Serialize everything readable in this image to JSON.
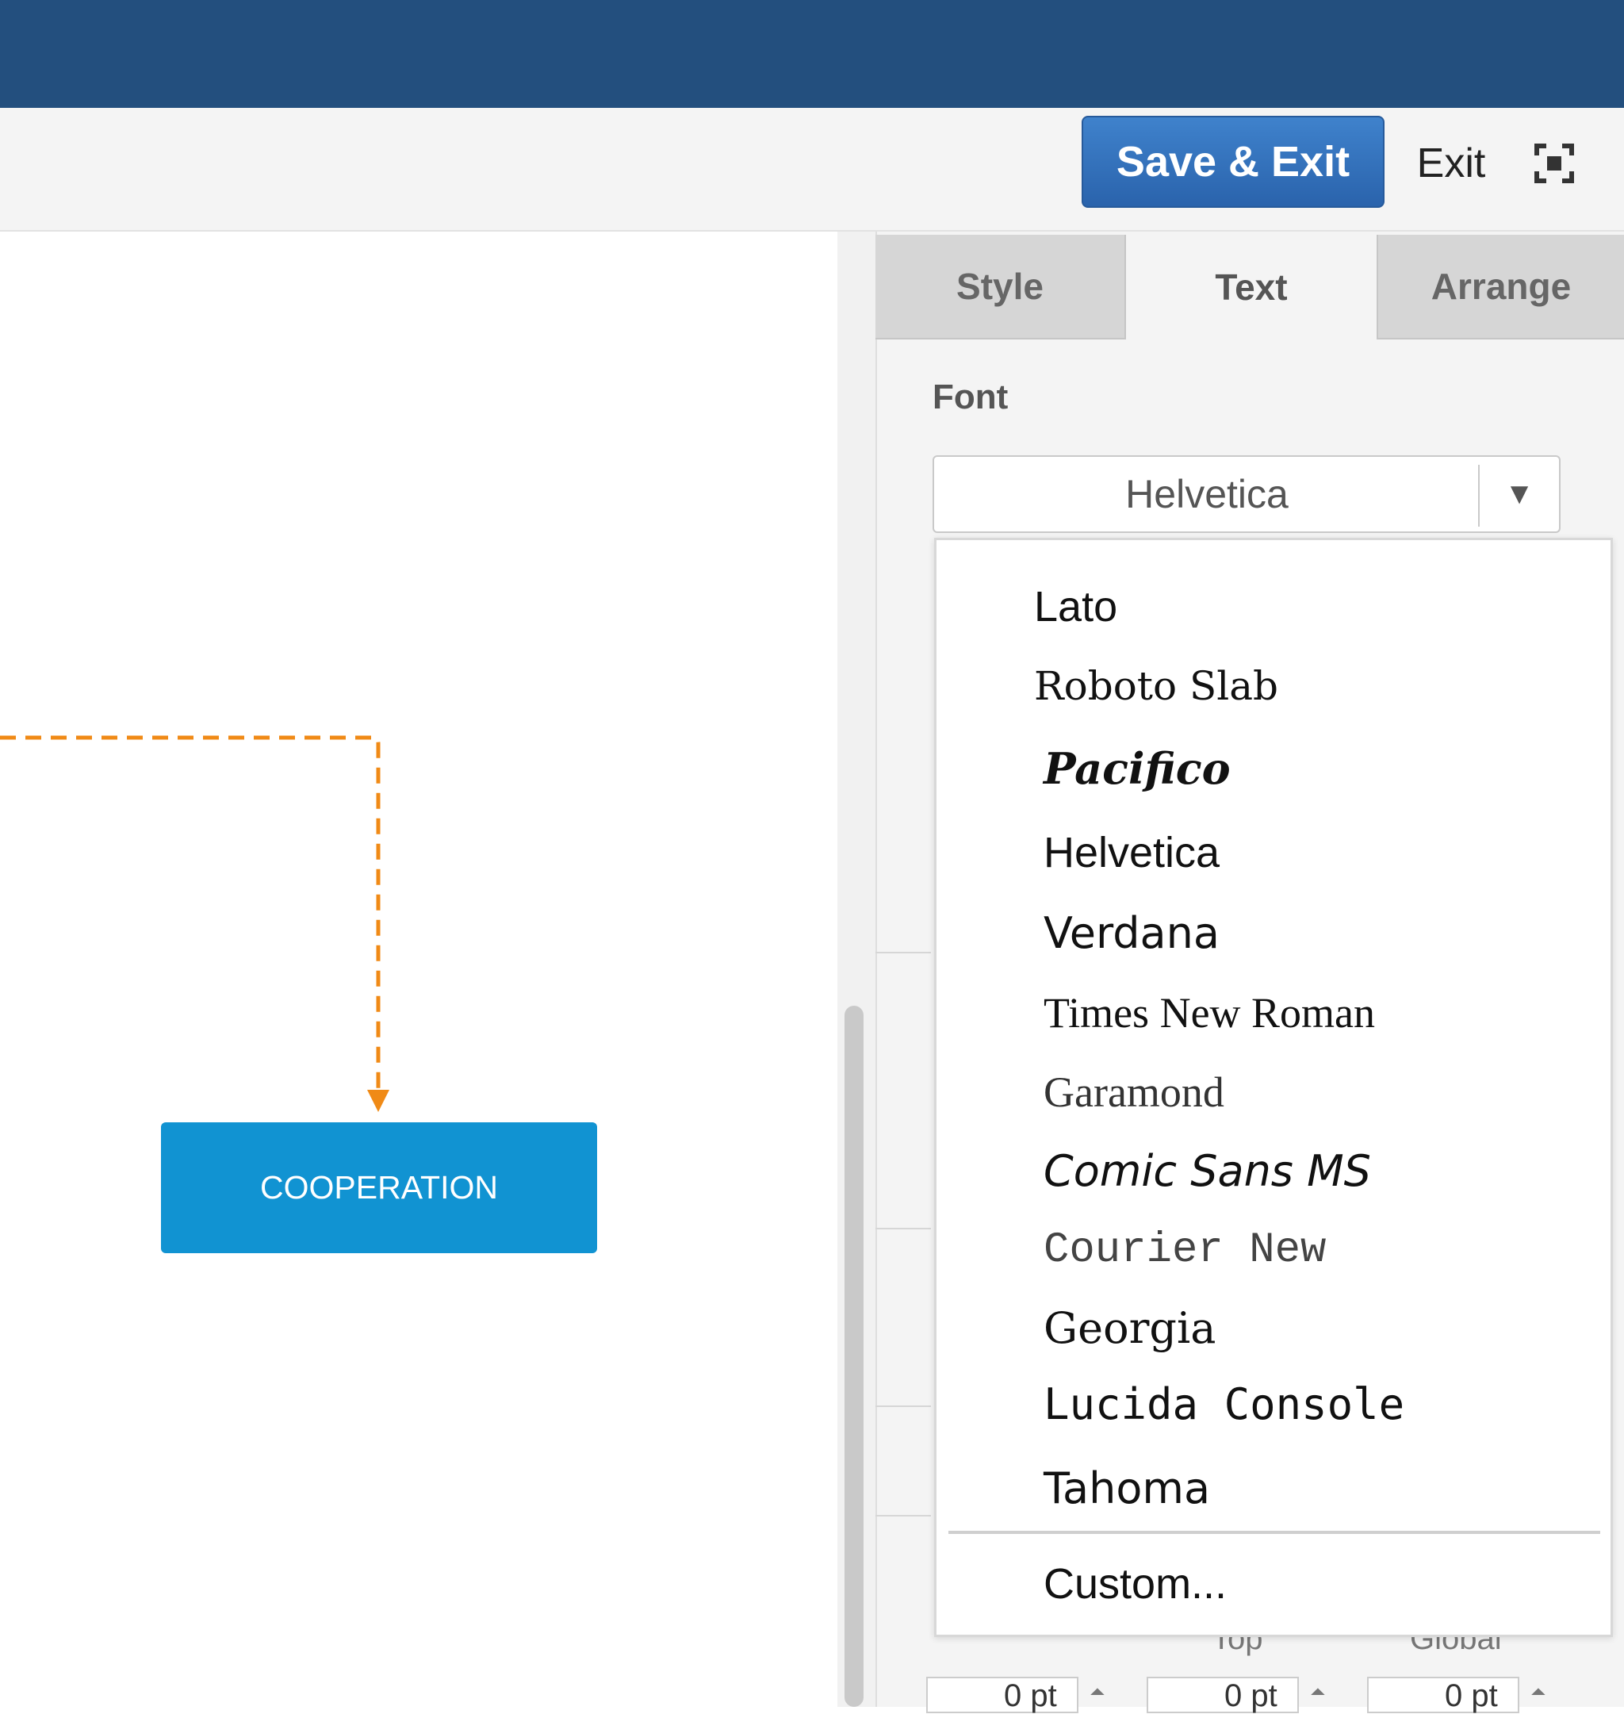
{
  "toolbar": {
    "save_exit_label": "Save & Exit",
    "exit_label": "Exit",
    "fullscreen_icon": "fullscreen-icon"
  },
  "canvas": {
    "shape_label": "COOPERATION",
    "connector_color": "#f08a16",
    "shape_color": "#1193d2"
  },
  "panel": {
    "tabs": [
      {
        "label": "Style"
      },
      {
        "label": "Text"
      },
      {
        "label": "Arrange"
      }
    ],
    "active_tab": "Text",
    "font_label": "Font",
    "font_value": "Helvetica",
    "font_options": [
      {
        "label": "Lato"
      },
      {
        "label": "Roboto Slab"
      },
      {
        "label": "Pacifico"
      },
      {
        "label": "Helvetica"
      },
      {
        "label": "Verdana"
      },
      {
        "label": "Times New Roman"
      },
      {
        "label": "Garamond"
      },
      {
        "label": "Comic Sans MS"
      },
      {
        "label": "Courier New"
      },
      {
        "label": "Georgia"
      },
      {
        "label": "Lucida Console"
      },
      {
        "label": "Tahoma"
      }
    ],
    "custom_label": "Custom...",
    "bottom": {
      "labels": [
        "Top",
        "Global"
      ],
      "values": [
        "0 pt",
        "0 pt",
        "0 pt"
      ]
    }
  },
  "colors": {
    "header": "#234f7e",
    "accent": "#2f6fb9"
  }
}
